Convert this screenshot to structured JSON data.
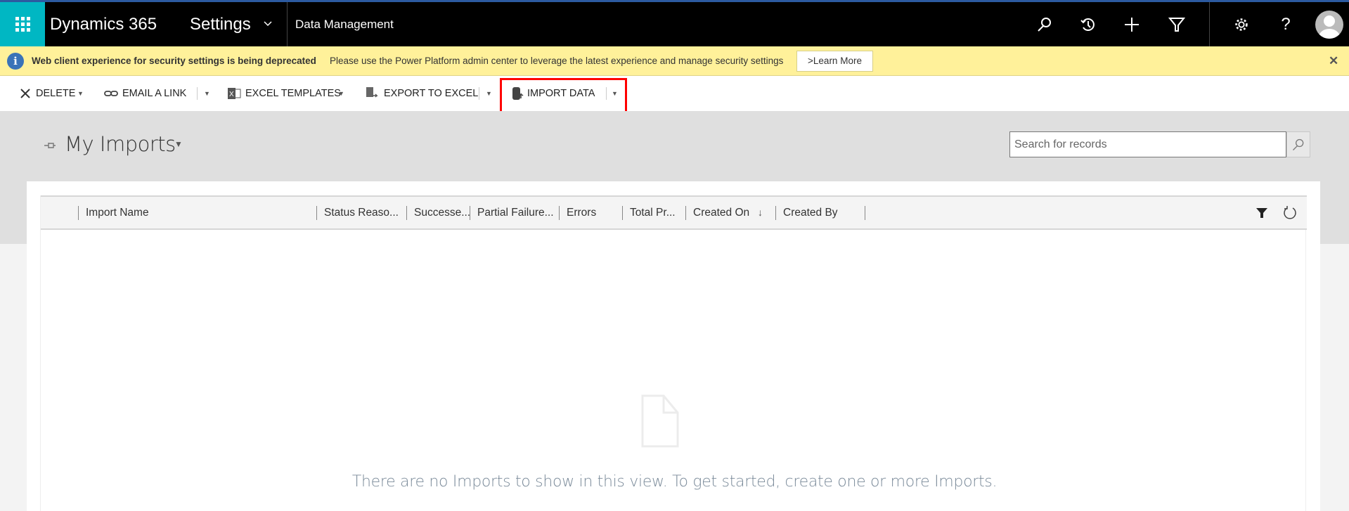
{
  "nav": {
    "app_name": "Dynamics 365",
    "area": "Settings",
    "breadcrumb": "Data Management",
    "icons": [
      "search-icon",
      "history-icon",
      "plus-icon",
      "filter-icon",
      "gear-icon",
      "help-icon",
      "avatar"
    ],
    "help_glyph": "?"
  },
  "banner": {
    "title": "Web client experience for security settings is being deprecated",
    "message": "Please use the Power Platform admin center to leverage the latest experience and manage security settings",
    "learn_more": ">Learn More",
    "info_glyph": "i",
    "close_glyph": "✕",
    "background": "#fff19a"
  },
  "toolbar": {
    "delete": "DELETE",
    "email_link": "EMAIL A LINK",
    "excel_templates": "EXCEL TEMPLATES",
    "export_excel": "EXPORT TO EXCEL",
    "import_data": "IMPORT DATA",
    "highlight_color": "#ff0000"
  },
  "view": {
    "title": "My Imports",
    "search_placeholder": "Search for records"
  },
  "grid": {
    "columns": [
      "Import Name",
      "Status Reaso...",
      "Successe...",
      "Partial Failure...",
      "Errors",
      "Total Pr...",
      "Created On",
      "Created By"
    ],
    "sort_indicator": "↓",
    "empty_message": "There are no Imports to show in this view. To get started, create one or more Imports."
  }
}
